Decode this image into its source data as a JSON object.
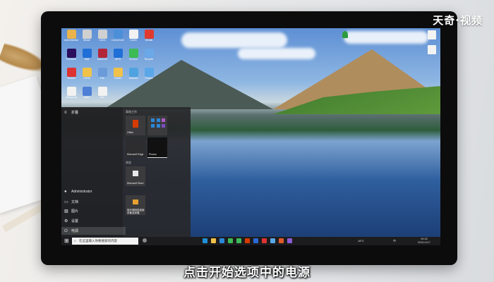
{
  "watermark": "天奇·视频",
  "subtitle": "点击开始选项中的电源",
  "desktop_icons": [
    {
      "label": "Administrator",
      "icon": "user-folder-icon",
      "color": "#e8b34a"
    },
    {
      "label": "Whale",
      "icon": "whale-icon",
      "color": "#d0d0d0"
    },
    {
      "label": "CAXA",
      "icon": "caxa-icon",
      "color": "#d0d0d0"
    },
    {
      "label": "CAXA/CAD",
      "icon": "cad-icon",
      "color": "#4c8fd8"
    },
    {
      "label": "CAXA",
      "icon": "doc-icon",
      "color": "#f2f2f2"
    },
    {
      "label": "Wetalk",
      "icon": "wetalk-icon",
      "color": "#e03a2f"
    },
    {
      "label": "Premiere",
      "icon": "premiere-icon",
      "color": "#2a0f5c"
    },
    {
      "label": "Mail",
      "icon": "mail-icon",
      "color": "#1f6fd6"
    },
    {
      "label": "AutoCAD",
      "icon": "autocad-icon",
      "color": "#b3263a"
    },
    {
      "label": "WPS",
      "icon": "wps-icon",
      "color": "#1f6fd6"
    },
    {
      "label": "Chrome",
      "icon": "chrome-icon",
      "color": "#3cba54"
    },
    {
      "label": "Recycle",
      "icon": "recycle-icon",
      "color": "#6aa8e8"
    },
    {
      "label": "Tencent",
      "icon": "qq-icon",
      "color": "#d33"
    },
    {
      "label": "CAXA",
      "icon": "folder-icon",
      "color": "#f0c24a"
    },
    {
      "label": "File",
      "icon": "file-icon",
      "color": "#6b9bd8"
    },
    {
      "label": "Folder",
      "icon": "folder-icon",
      "color": "#f0c24a"
    },
    {
      "label": "Network",
      "icon": "network-icon",
      "color": "#4fa3e0"
    },
    {
      "label": "Photos",
      "icon": "photos-icon",
      "color": "#5aa7e8"
    },
    {
      "label": "debug.log",
      "icon": "file-icon",
      "color": "#f2f2f2"
    },
    {
      "label": "Apps",
      "icon": "grid-icon",
      "color": "#4d7fd6"
    },
    {
      "label": "Doc",
      "icon": "file-icon",
      "color": "#f2f2f2"
    }
  ],
  "start_menu": {
    "header": "折叠",
    "user": "Administrator",
    "items": [
      {
        "label": "文档",
        "icon": "document-icon"
      },
      {
        "label": "图片",
        "icon": "picture-icon"
      },
      {
        "label": "设置",
        "icon": "gear-icon"
      },
      {
        "label": "电源",
        "icon": "power-icon"
      }
    ],
    "sections": [
      {
        "title": "高效工作",
        "tiles": [
          "Office",
          "",
          "Microsoft Edge",
          "Photos"
        ]
      },
      {
        "title": "浏览",
        "tiles": [
          "Microsoft Store",
          "施乐德网络桌面设备选择器"
        ]
      }
    ]
  },
  "taskbar": {
    "search_placeholder": "在这里输入你要搜索的内容",
    "weather": "18°C",
    "tray_text": "中",
    "time": "19:02",
    "date": "2021/1/17"
  }
}
